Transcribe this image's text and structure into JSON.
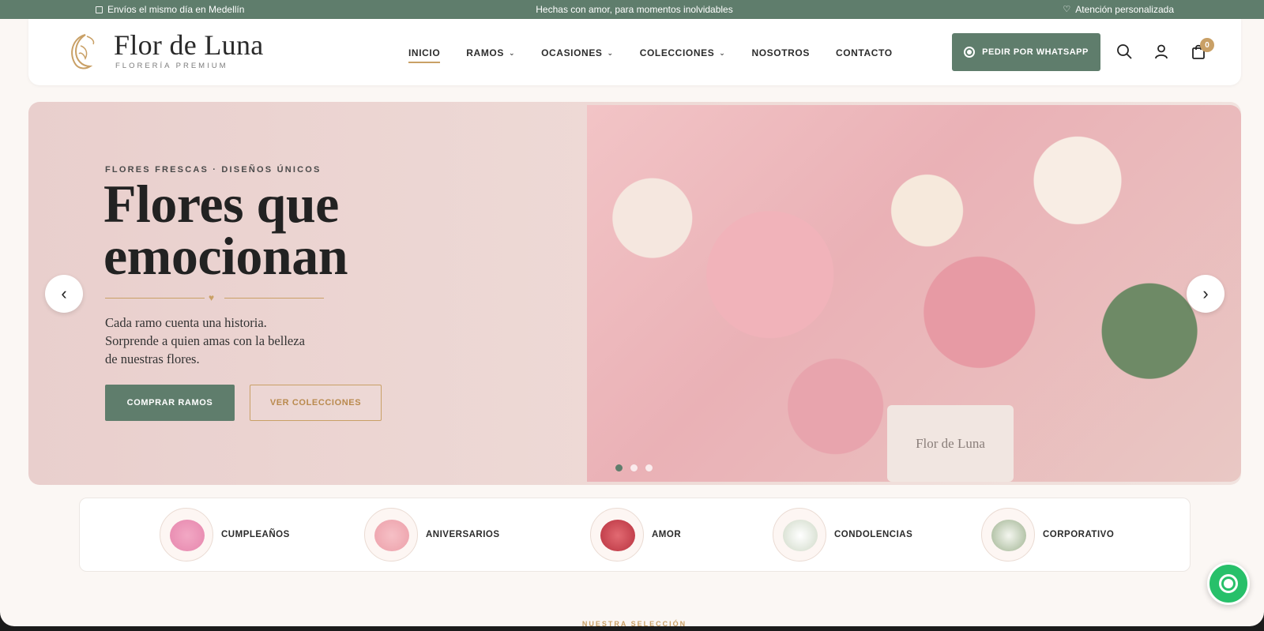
{
  "topbar": {
    "left": "Envíos el mismo día en Medellín",
    "center": "Hechas con amor, para momentos inolvidables",
    "right": "Atención personalizada"
  },
  "brand": {
    "name": "Flor de Luna",
    "tagline": "FLORERÍA PREMIUM"
  },
  "nav": [
    {
      "label": "INICIO",
      "active": true,
      "dropdown": false
    },
    {
      "label": "RAMOS",
      "active": false,
      "dropdown": true
    },
    {
      "label": "OCASIONES",
      "active": false,
      "dropdown": true
    },
    {
      "label": "COLECCIONES",
      "active": false,
      "dropdown": true
    },
    {
      "label": "NOSOTROS",
      "active": false,
      "dropdown": false
    },
    {
      "label": "CONTACTO",
      "active": false,
      "dropdown": false
    }
  ],
  "header": {
    "whatsapp_label": "PEDIR POR WHATSAPP",
    "cart_count": "0"
  },
  "hero": {
    "eyebrow": "FLORES FRESCAS · DISEÑOS ÚNICOS",
    "title_line1": "Flores que",
    "title_line2": "emocionan",
    "subtitle_line1": "Cada ramo cuenta una historia.",
    "subtitle_line2": "Sorprende a quien amas con la belleza",
    "subtitle_line3": "de nuestras flores.",
    "primary_cta": "COMPRAR RAMOS",
    "secondary_cta": "VER COLECCIONES",
    "card_text": "Flor de Luna",
    "slides": 3,
    "active_slide": 1
  },
  "categories": [
    {
      "label": "CUMPLEAÑOS"
    },
    {
      "label": "ANIVERSARIOS"
    },
    {
      "label": "AMOR"
    },
    {
      "label": "CONDOLENCIAS"
    },
    {
      "label": "CORPORATIVO"
    }
  ],
  "section_hint": "NUESTRA SELECCIÓN",
  "colors": {
    "primary_green": "#5f7d6c",
    "accent_gold": "#c9a066",
    "hero_pink": "#e9cfcd",
    "whatsapp_green": "#27c06a"
  },
  "icons": [
    "calendar-icon",
    "heart-icon",
    "moon-logo-icon",
    "search-icon",
    "user-icon",
    "bag-icon",
    "chevron-left-icon",
    "chevron-right-icon",
    "whatsapp-icon"
  ]
}
